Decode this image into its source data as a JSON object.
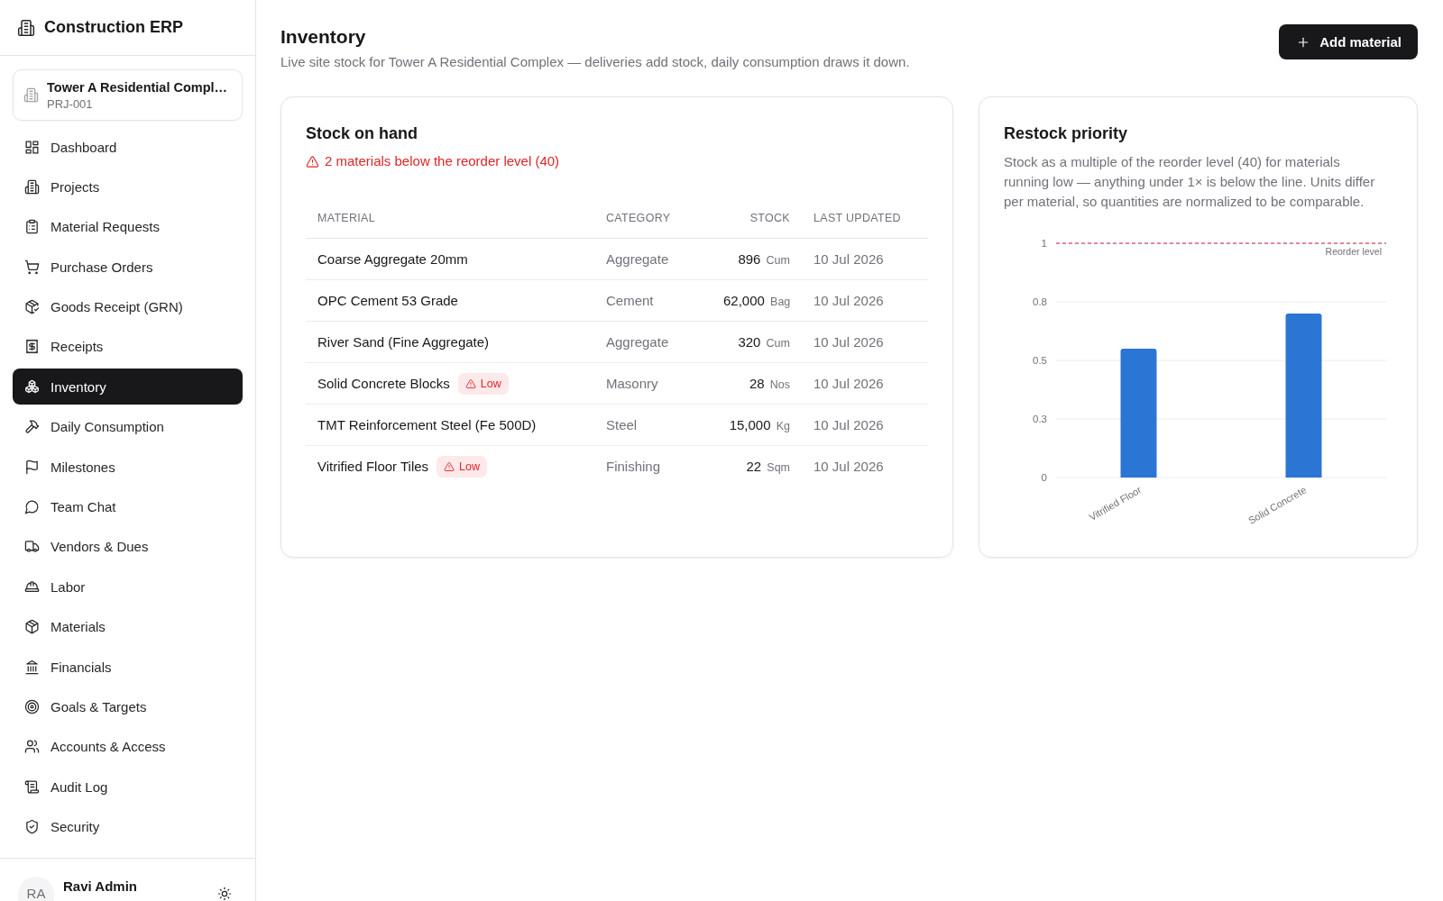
{
  "sidebar": {
    "brand": "Construction ERP",
    "project": {
      "name": "Tower A Residential Compl…",
      "code": "PRJ-001"
    },
    "nav": [
      {
        "label": "Dashboard",
        "selected": false
      },
      {
        "label": "Projects",
        "selected": false
      },
      {
        "label": "Material Requests",
        "selected": false
      },
      {
        "label": "Purchase Orders",
        "selected": false
      },
      {
        "label": "Goods Receipt (GRN)",
        "selected": false
      },
      {
        "label": "Receipts",
        "selected": false
      },
      {
        "label": "Inventory",
        "selected": true
      },
      {
        "label": "Daily Consumption",
        "selected": false
      },
      {
        "label": "Milestones",
        "selected": false
      },
      {
        "label": "Team Chat",
        "selected": false
      },
      {
        "label": "Vendors & Dues",
        "selected": false
      },
      {
        "label": "Labor",
        "selected": false
      },
      {
        "label": "Materials",
        "selected": false
      },
      {
        "label": "Financials",
        "selected": false
      },
      {
        "label": "Goals & Targets",
        "selected": false
      },
      {
        "label": "Accounts & Access",
        "selected": false
      },
      {
        "label": "Audit Log",
        "selected": false
      },
      {
        "label": "Security",
        "selected": false
      }
    ],
    "user": {
      "initials": "RA",
      "name": "Ravi Admin"
    }
  },
  "header": {
    "title": "Inventory",
    "subtitle": "Live site stock for Tower A Residential Complex — deliveries add stock, daily consumption draws it down.",
    "action": "Add material"
  },
  "stock_card": {
    "title": "Stock on hand",
    "alert": "2 materials below the reorder level (40)",
    "table": {
      "columns": [
        "MATERIAL",
        "CATEGORY",
        "STOCK",
        "LAST UPDATED"
      ],
      "rows": [
        {
          "material": "Coarse Aggregate 20mm",
          "category": "Aggregate",
          "stock": "896",
          "unit": "Cum",
          "updated": "10 Jul 2026"
        },
        {
          "material": "OPC Cement 53 Grade",
          "category": "Cement",
          "stock": "62,000",
          "unit": "Bag",
          "updated": "10 Jul 2026"
        },
        {
          "material": "River Sand (Fine Aggregate)",
          "category": "Aggregate",
          "stock": "320",
          "unit": "Cum",
          "updated": "10 Jul 2026"
        },
        {
          "material": "Solid Concrete Blocks",
          "badge": "Low",
          "category": "Masonry",
          "stock": "28",
          "unit": "Nos",
          "updated": "10 Jul 2026"
        },
        {
          "material": "TMT Reinforcement Steel (Fe 500D)",
          "category": "Steel",
          "stock": "15,000",
          "unit": "Kg",
          "updated": "10 Jul 2026"
        },
        {
          "material": "Vitrified Floor Tiles",
          "badge": "Low",
          "category": "Finishing",
          "stock": "22",
          "unit": "Sqm",
          "updated": "10 Jul 2026"
        }
      ]
    }
  },
  "restock_card": {
    "title": "Restock priority",
    "description": "Stock as a multiple of the reorder level (40) for materials running low — anything under 1× is below the line. Units differ per material, so quantities are normalized to be comparable.",
    "chart_data": {
      "type": "bar",
      "categories": [
        "Vitrified Floor",
        "Solid Concrete"
      ],
      "values": [
        0.55,
        0.7
      ],
      "ylim": [
        0,
        1
      ],
      "yticks": [
        0,
        {
          "value": 0.25,
          "label": "0.3"
        },
        0.5,
        {
          "value": 0.75,
          "label": "0.8"
        },
        1
      ],
      "grid": true,
      "ref_lines": [
        {
          "axis": "y",
          "value": 1,
          "label": "Reorder level"
        }
      ]
    }
  }
}
